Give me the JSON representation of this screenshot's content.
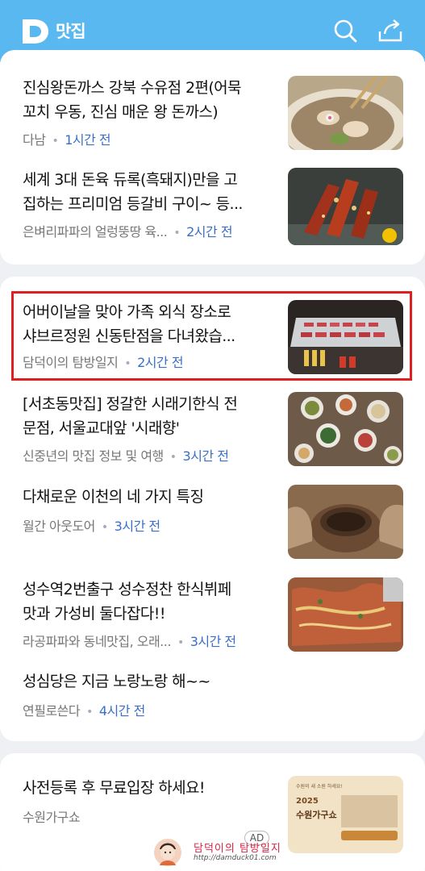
{
  "header": {
    "logo_text": "맛집",
    "brand_color": "#5ab8f0"
  },
  "articles": [
    {
      "title": "진심왕돈까스 강북 수유점 2편(어묵\n꼬치 우동, 진심 매운 왕 돈까스)",
      "source": "다남",
      "time": "1시간 전",
      "thumb": "udon-bowl-image"
    },
    {
      "title": "세계 3대 돈육 듀록(흑돼지)만을 고\n집하는 프리미엄 등갈비 구이~ 등...",
      "source": "은벼리파파의 얼렁뚱땅 육...",
      "time": "2시간 전",
      "thumb": "grilled-ribs-image"
    },
    {
      "title": "어버이날을 맞아 가족 외식 장소로\n샤브르정원 신동탄점을 다녀왔습...",
      "source": "담덕이의 탐방일지",
      "time": "2시간 전",
      "thumb": "meat-display-image"
    },
    {
      "title": "[서초동맛집] 정갈한 시래기한식 전\n문점, 서울교대앞 '시래향'",
      "source": "신중년의 맛집 정보 및 여행",
      "time": "3시간 전",
      "thumb": "korean-table-image"
    },
    {
      "title": "다채로운 이천의 네 가지 특징",
      "source": "월간 아웃도어",
      "time": "3시간 전",
      "thumb": "pottery-image"
    },
    {
      "title": "성수역2번출구 성수정찬 한식뷔페\n맛과 가성비 둘다잡다!!",
      "source": "라공파파와 동네맛집, 오래...",
      "time": "3시간 전",
      "thumb": "buffet-image"
    },
    {
      "title": "성심당은 지금 노랑노랑 해~~",
      "source": "연필로쓴다",
      "time": "4시간 전",
      "thumb": ""
    },
    {
      "title": "사전등록 후 무료입장 하세요!",
      "source": "수원가구쇼",
      "time": "",
      "thumb": "furniture-show-ad-image"
    }
  ],
  "ad": {
    "badge": "AD",
    "poster_line1": "수원의 새 소원 하세요!",
    "poster_year": "2025",
    "poster_title": "수원가구쇼"
  },
  "watermark": {
    "name": "담덕이의 탐방일지",
    "url": "http://damduck01.com"
  }
}
